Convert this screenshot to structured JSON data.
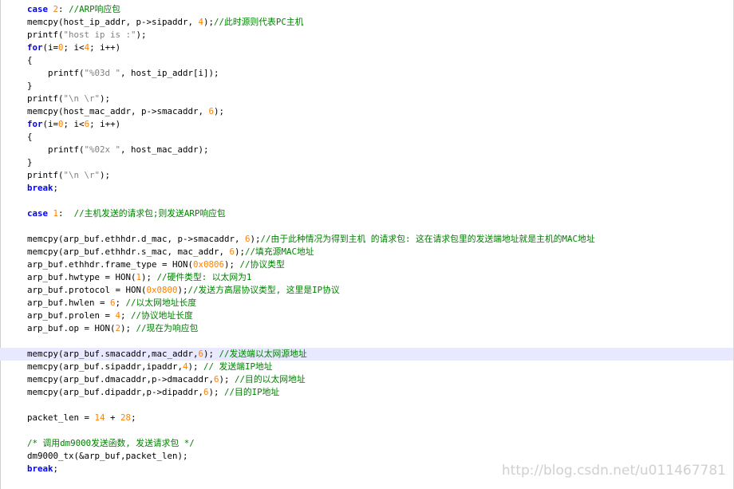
{
  "colors": {
    "keyword": "#0000ff",
    "comment": "#008000",
    "number": "#ff8000",
    "string": "#808080",
    "highlight": "#e8e8ff"
  },
  "watermark": "http://blog.csdn.net/u011467781",
  "lines": [
    {
      "hl": false,
      "segments": [
        {
          "t": "kw",
          "v": "case"
        },
        {
          "t": "",
          "v": " "
        },
        {
          "t": "num",
          "v": "2"
        },
        {
          "t": "",
          "v": ": "
        },
        {
          "t": "cm",
          "v": "//ARP响应包"
        }
      ]
    },
    {
      "hl": false,
      "segments": [
        {
          "t": "",
          "v": "memcpy(host_ip_addr, p->sipaddr, "
        },
        {
          "t": "num",
          "v": "4"
        },
        {
          "t": "",
          "v": ");"
        },
        {
          "t": "cm",
          "v": "//此时源则代表PC主机"
        }
      ]
    },
    {
      "hl": false,
      "segments": [
        {
          "t": "",
          "v": "printf("
        },
        {
          "t": "str",
          "v": "\"host ip is :\""
        },
        {
          "t": "",
          "v": ");"
        }
      ]
    },
    {
      "hl": false,
      "segments": [
        {
          "t": "kw",
          "v": "for"
        },
        {
          "t": "",
          "v": "(i="
        },
        {
          "t": "num",
          "v": "0"
        },
        {
          "t": "",
          "v": "; i<"
        },
        {
          "t": "num",
          "v": "4"
        },
        {
          "t": "",
          "v": "; i++)"
        }
      ]
    },
    {
      "hl": false,
      "segments": [
        {
          "t": "",
          "v": "{"
        }
      ]
    },
    {
      "hl": false,
      "segments": [
        {
          "t": "",
          "v": "    printf("
        },
        {
          "t": "str",
          "v": "\"%03d \""
        },
        {
          "t": "",
          "v": ", host_ip_addr[i]);"
        }
      ]
    },
    {
      "hl": false,
      "segments": [
        {
          "t": "",
          "v": "}"
        }
      ]
    },
    {
      "hl": false,
      "segments": [
        {
          "t": "",
          "v": "printf("
        },
        {
          "t": "str",
          "v": "\"\\n \\r\""
        },
        {
          "t": "",
          "v": ");"
        }
      ]
    },
    {
      "hl": false,
      "segments": [
        {
          "t": "",
          "v": "memcpy(host_mac_addr, p->smacaddr, "
        },
        {
          "t": "num",
          "v": "6"
        },
        {
          "t": "",
          "v": ");"
        }
      ]
    },
    {
      "hl": false,
      "segments": [
        {
          "t": "kw",
          "v": "for"
        },
        {
          "t": "",
          "v": "(i="
        },
        {
          "t": "num",
          "v": "0"
        },
        {
          "t": "",
          "v": "; i<"
        },
        {
          "t": "num",
          "v": "6"
        },
        {
          "t": "",
          "v": "; i++)"
        }
      ]
    },
    {
      "hl": false,
      "segments": [
        {
          "t": "",
          "v": "{"
        }
      ]
    },
    {
      "hl": false,
      "segments": [
        {
          "t": "",
          "v": "    printf("
        },
        {
          "t": "str",
          "v": "\"%02x \""
        },
        {
          "t": "",
          "v": ", host_mac_addr);"
        }
      ]
    },
    {
      "hl": false,
      "segments": [
        {
          "t": "",
          "v": "}"
        }
      ]
    },
    {
      "hl": false,
      "segments": [
        {
          "t": "",
          "v": "printf("
        },
        {
          "t": "str",
          "v": "\"\\n \\r\""
        },
        {
          "t": "",
          "v": ");"
        }
      ]
    },
    {
      "hl": false,
      "segments": [
        {
          "t": "kw",
          "v": "break"
        },
        {
          "t": "",
          "v": ";"
        }
      ]
    },
    {
      "hl": false,
      "segments": []
    },
    {
      "hl": false,
      "segments": [
        {
          "t": "kw",
          "v": "case"
        },
        {
          "t": "",
          "v": " "
        },
        {
          "t": "num",
          "v": "1"
        },
        {
          "t": "",
          "v": ":  "
        },
        {
          "t": "cm",
          "v": "//主机发送的请求包;则发送ARP响应包"
        }
      ]
    },
    {
      "hl": false,
      "segments": []
    },
    {
      "hl": false,
      "segments": [
        {
          "t": "",
          "v": "memcpy(arp_buf.ethhdr.d_mac, p->smacaddr, "
        },
        {
          "t": "num",
          "v": "6"
        },
        {
          "t": "",
          "v": ");"
        },
        {
          "t": "cm",
          "v": "//由于此种情况为得到主机 的请求包: 这在请求包里的发送端地址就是主机的MAC地址"
        }
      ]
    },
    {
      "hl": false,
      "segments": [
        {
          "t": "",
          "v": "memcpy(arp_buf.ethhdr.s_mac, mac_addr, "
        },
        {
          "t": "num",
          "v": "6"
        },
        {
          "t": "",
          "v": ");"
        },
        {
          "t": "cm",
          "v": "//填充源MAC地址"
        }
      ]
    },
    {
      "hl": false,
      "segments": [
        {
          "t": "",
          "v": "arp_buf.ethhdr.frame_type = HON("
        },
        {
          "t": "num",
          "v": "0x0806"
        },
        {
          "t": "",
          "v": "); "
        },
        {
          "t": "cm",
          "v": "//协议类型"
        }
      ]
    },
    {
      "hl": false,
      "segments": [
        {
          "t": "",
          "v": "arp_buf.hwtype = HON("
        },
        {
          "t": "num",
          "v": "1"
        },
        {
          "t": "",
          "v": "); "
        },
        {
          "t": "cm",
          "v": "//硬件类型: 以太网为1"
        }
      ]
    },
    {
      "hl": false,
      "segments": [
        {
          "t": "",
          "v": "arp_buf.protocol = HON("
        },
        {
          "t": "num",
          "v": "0x0800"
        },
        {
          "t": "",
          "v": ");"
        },
        {
          "t": "cm",
          "v": "//发送方高层协议类型, 这里是IP协议"
        }
      ]
    },
    {
      "hl": false,
      "segments": [
        {
          "t": "",
          "v": "arp_buf.hwlen = "
        },
        {
          "t": "num",
          "v": "6"
        },
        {
          "t": "",
          "v": "; "
        },
        {
          "t": "cm",
          "v": "//以太网地址长度"
        }
      ]
    },
    {
      "hl": false,
      "segments": [
        {
          "t": "",
          "v": "arp_buf.prolen = "
        },
        {
          "t": "num",
          "v": "4"
        },
        {
          "t": "",
          "v": "; "
        },
        {
          "t": "cm",
          "v": "//协议地址长度"
        }
      ]
    },
    {
      "hl": false,
      "segments": [
        {
          "t": "",
          "v": "arp_buf.op = HON("
        },
        {
          "t": "num",
          "v": "2"
        },
        {
          "t": "",
          "v": "); "
        },
        {
          "t": "cm",
          "v": "//现在为响应包"
        }
      ]
    },
    {
      "hl": false,
      "segments": []
    },
    {
      "hl": true,
      "segments": [
        {
          "t": "",
          "v": "memcpy(arp_buf.smacaddr,mac_addr,"
        },
        {
          "t": "num",
          "v": "6"
        },
        {
          "t": "",
          "v": "); "
        },
        {
          "t": "cm",
          "v": "//发送端以太网源地址"
        }
      ]
    },
    {
      "hl": false,
      "segments": [
        {
          "t": "",
          "v": "memcpy(arp_buf.sipaddr,ipaddr,"
        },
        {
          "t": "num",
          "v": "4"
        },
        {
          "t": "",
          "v": "); "
        },
        {
          "t": "cm",
          "v": "// 发送端IP地址"
        }
      ]
    },
    {
      "hl": false,
      "segments": [
        {
          "t": "",
          "v": "memcpy(arp_buf.dmacaddr,p->dmacaddr,"
        },
        {
          "t": "num",
          "v": "6"
        },
        {
          "t": "",
          "v": "); "
        },
        {
          "t": "cm",
          "v": "//目的以太网地址"
        }
      ]
    },
    {
      "hl": false,
      "segments": [
        {
          "t": "",
          "v": "memcpy(arp_buf.dipaddr,p->dipaddr,"
        },
        {
          "t": "num",
          "v": "6"
        },
        {
          "t": "",
          "v": "); "
        },
        {
          "t": "cm",
          "v": "//目的IP地址"
        }
      ]
    },
    {
      "hl": false,
      "segments": []
    },
    {
      "hl": false,
      "segments": [
        {
          "t": "",
          "v": "packet_len = "
        },
        {
          "t": "num",
          "v": "14"
        },
        {
          "t": "",
          "v": " + "
        },
        {
          "t": "num",
          "v": "28"
        },
        {
          "t": "",
          "v": ";"
        }
      ]
    },
    {
      "hl": false,
      "segments": []
    },
    {
      "hl": false,
      "segments": [
        {
          "t": "cm",
          "v": "/* 调用dm9000发送函数, 发送请求包 */"
        }
      ]
    },
    {
      "hl": false,
      "segments": [
        {
          "t": "",
          "v": "dm9000_tx(&arp_buf,packet_len);"
        }
      ]
    },
    {
      "hl": false,
      "segments": [
        {
          "t": "kw",
          "v": "break"
        },
        {
          "t": "",
          "v": ";"
        }
      ]
    }
  ]
}
